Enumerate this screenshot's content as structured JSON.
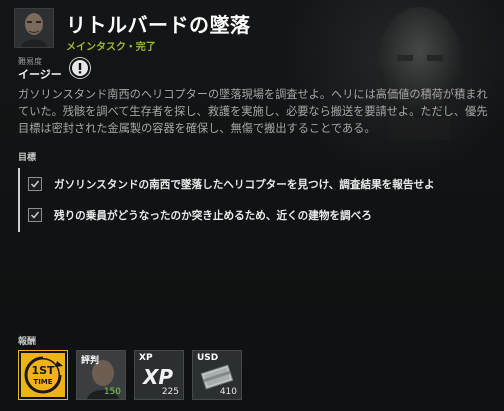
{
  "quest": {
    "title": "リトルバードの墜落",
    "subtitle": "メインタスク・完了"
  },
  "difficulty": {
    "label": "難易度",
    "value": "イージー"
  },
  "description": "ガソリンスタンド南西のヘリコプターの墜落現場を調査せよ。ヘリには高価値の積荷が積まれていた。残骸を調べて生存者を探し、救護を実施し、必要なら搬送を要請せよ。ただし、優先目標は密封された金属製の容器を確保し、無傷で搬出することである。",
  "objectives": {
    "label": "目標",
    "items": [
      {
        "text": "ガソリンスタンドの南西で墜落したヘリコプターを見つけ、調査結果を報告せよ",
        "checked": true
      },
      {
        "text": "残りの乗員がどうなったのか突き止めるため、近くの建物を調べろ",
        "checked": true
      }
    ]
  },
  "rewards": {
    "label": "報酬",
    "items": [
      {
        "title": "",
        "value": "",
        "icon": "first-time-badge-icon"
      },
      {
        "title": "評判",
        "value": "150",
        "icon": "reputation-portrait-icon"
      },
      {
        "title": "XP",
        "value": "225",
        "icon": "xp-icon"
      },
      {
        "title": "USD",
        "value": "410",
        "icon": "cash-stack-icon"
      }
    ]
  },
  "colors": {
    "subtitle": "#9bbb35",
    "first_time_badge": "#f0b21b",
    "reputation_value": "#7fcf3a"
  }
}
